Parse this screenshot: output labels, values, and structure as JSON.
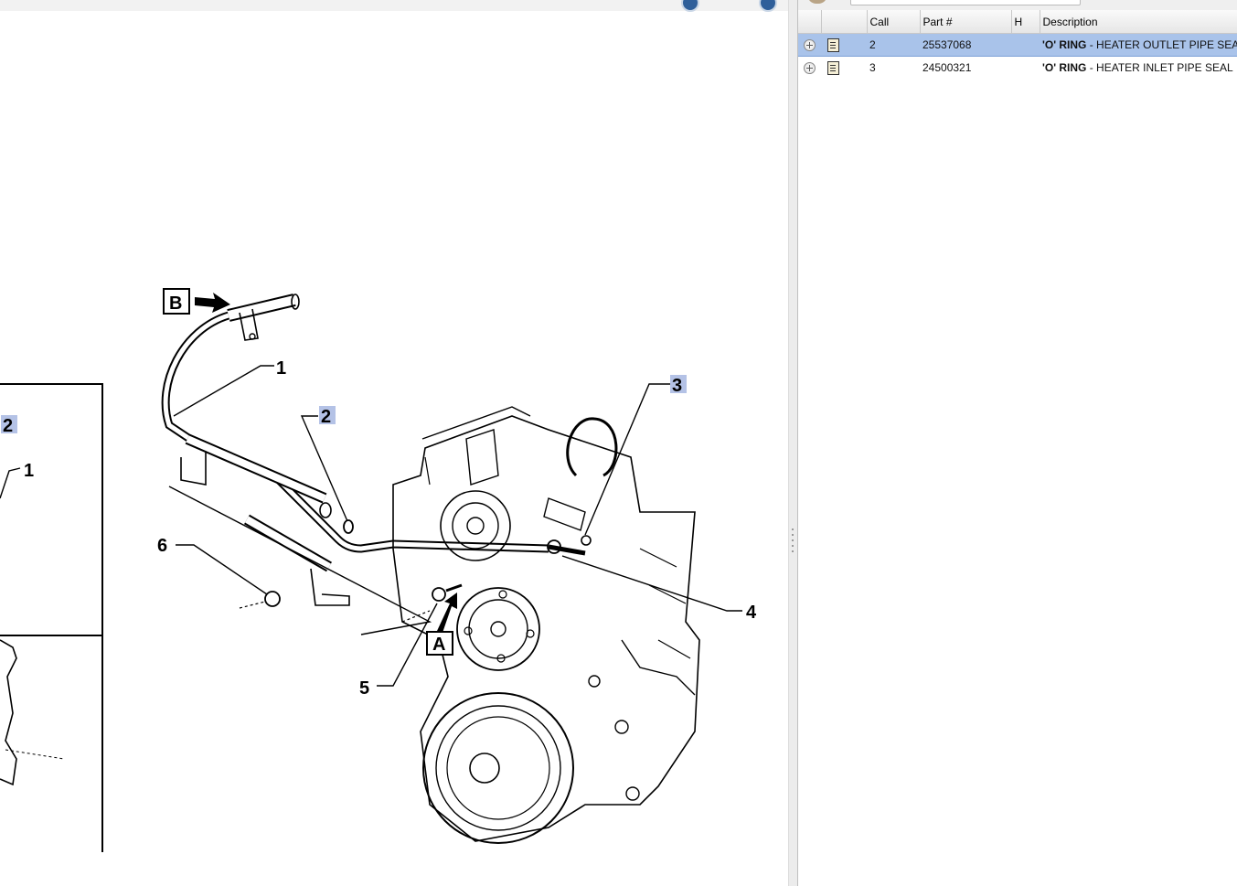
{
  "diagram": {
    "callouts": {
      "c1": "1",
      "c2": "2",
      "c3": "3",
      "c4": "4",
      "c5": "5",
      "c6": "6",
      "cA": "A",
      "cB": "B",
      "inset_c2": "2",
      "inset_c1": "1"
    },
    "highlight_color": "#b4c2e6"
  },
  "parts_table": {
    "headers": {
      "col_expand": "",
      "col_icon": "",
      "call": "Call",
      "part": "Part #",
      "h": "H",
      "description": "Description"
    },
    "rows": [
      {
        "call": "2",
        "part": "25537068",
        "h": "",
        "desc_name": "'O' RING",
        "desc_rest": " - HEATER OUTLET PIPE SEAL",
        "selected": true
      },
      {
        "call": "3",
        "part": "24500321",
        "h": "",
        "desc_name": "'O' RING",
        "desc_rest": " - HEATER INLET PIPE SEAL",
        "selected": false
      }
    ],
    "selected_color": "#a9c3ea"
  },
  "icons": [
    "expand-row-icon",
    "document-icon",
    "nav-prev-icon",
    "nav-next-icon"
  ]
}
